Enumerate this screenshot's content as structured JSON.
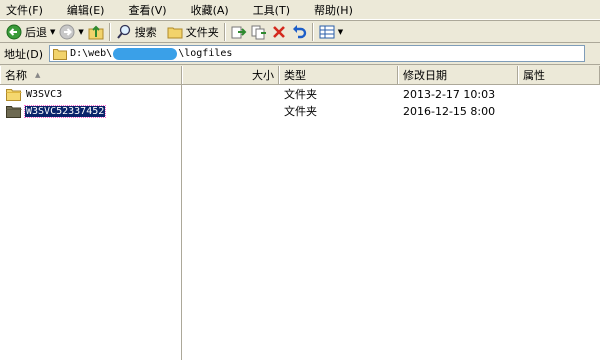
{
  "menu": [
    "文件(F)",
    "编辑(E)",
    "查看(V)",
    "收藏(A)",
    "工具(T)",
    "帮助(H)"
  ],
  "toolbar": {
    "back_label": "后退",
    "search_label": "搜索",
    "folders_label": "文件夹"
  },
  "address": {
    "label": "地址(D)",
    "path_prefix": "D:\\web\\",
    "path_suffix": "\\logfiles"
  },
  "columns": {
    "name": "名称",
    "size": "大小",
    "type": "类型",
    "modified": "修改日期",
    "attributes": "属性"
  },
  "files": [
    {
      "name": "W3SVC3",
      "type": "文件夹",
      "modified": "2013-2-17 10:03"
    },
    {
      "name": "W3SVC52337452",
      "type": "文件夹",
      "modified": "2016-12-15 8:00"
    }
  ],
  "colors": {
    "selection": "#0a246a",
    "chrome": "#ece9d8",
    "accent": "#3aa0e8"
  }
}
